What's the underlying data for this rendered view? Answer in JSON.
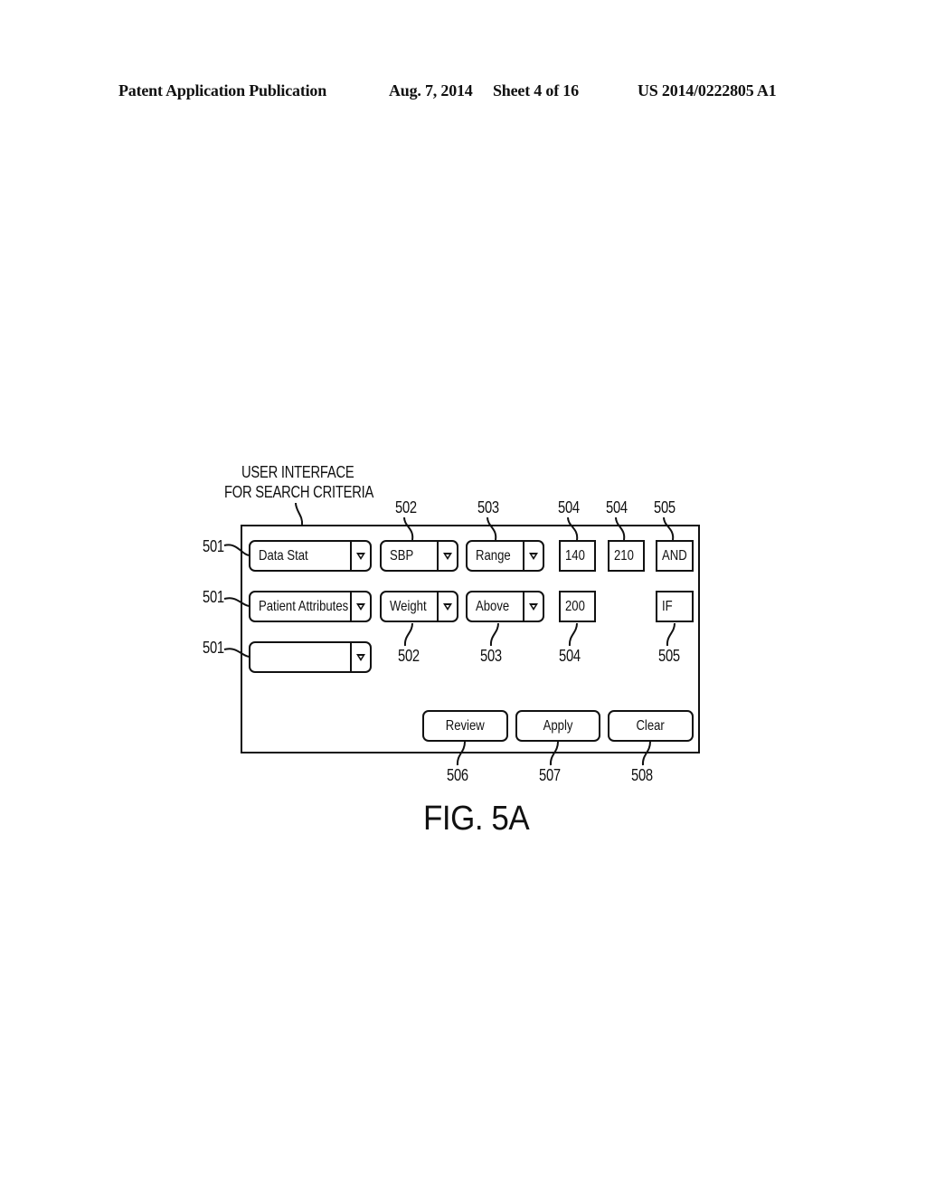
{
  "header": {
    "publication": "Patent Application Publication",
    "date": "Aug. 7, 2014",
    "sheet": "Sheet 4 of 16",
    "number": "US 2014/0222805 A1"
  },
  "figure": {
    "title_line1": "USER INTERFACE",
    "title_line2": "FOR SEARCH CRITERIA",
    "caption": "FIG. 5A",
    "rows": [
      {
        "category": {
          "value": "Data Stat",
          "ref": "501"
        },
        "parameter": {
          "value": "SBP",
          "ref": "502"
        },
        "operator": {
          "value": "Range",
          "ref": "503"
        },
        "value1": {
          "value": "140",
          "ref": "504"
        },
        "value2": {
          "value": "210",
          "ref": "504"
        },
        "logic": {
          "value": "AND",
          "ref": "505"
        }
      },
      {
        "category": {
          "value": "Patient Attributes",
          "ref": "501"
        },
        "parameter": {
          "value": "Weight",
          "ref": "502"
        },
        "operator": {
          "value": "Above",
          "ref": "503"
        },
        "value1": {
          "value": "200",
          "ref": "504"
        },
        "logic": {
          "value": "IF",
          "ref": "505"
        }
      },
      {
        "category": {
          "value": "",
          "ref": "501"
        }
      }
    ],
    "buttons": [
      {
        "label": "Review",
        "ref": "506"
      },
      {
        "label": "Apply",
        "ref": "507"
      },
      {
        "label": "Clear",
        "ref": "508"
      }
    ],
    "icons": {
      "dropdown": "triangle-down-icon"
    }
  }
}
